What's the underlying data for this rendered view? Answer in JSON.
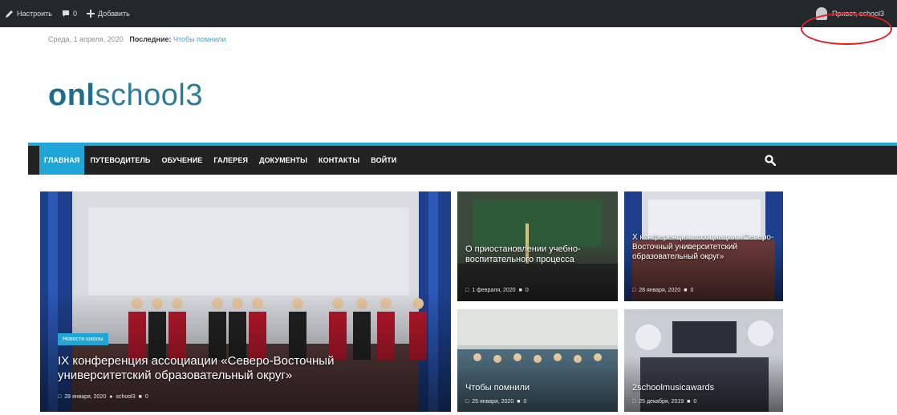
{
  "admin_bar": {
    "customize": "Настроить",
    "comments_count": "0",
    "add_new": "Добавить",
    "howdy": "Привет, school3"
  },
  "top_info": {
    "date": "Среда, 1 апреля, 2020",
    "latest_label": "Последние:",
    "latest_link": "Чтобы помнили"
  },
  "logo": {
    "text_bold": "onl",
    "text_rest": "school3"
  },
  "nav": {
    "items": [
      "ГЛАВНАЯ",
      "ПУТЕВОДИТЕЛЬ",
      "ОБУЧЕНИЕ",
      "ГАЛЕРЕЯ",
      "ДОКУМЕНТЫ",
      "КОНТАКТЫ",
      "ВОЙТИ"
    ]
  },
  "featured": {
    "category": "Новости школы",
    "title_line1": "IX конференция ассоциации «Северо-Восточный",
    "title_line2": "университетский образовательный округ»",
    "date": "28 января, 2020",
    "author": "school3",
    "comments": "0"
  },
  "tiles": [
    {
      "title": "О приостановлении учебно-воспитательного процесса",
      "date": "1 февраля, 2020",
      "comments": "0"
    },
    {
      "title": "Х конференция ассоциации «Северо-Восточный университетский образовательный округ»",
      "date": "28 января, 2020",
      "comments": "0"
    },
    {
      "title": "Чтобы помнили",
      "date": "25 января, 2020",
      "comments": "0"
    },
    {
      "title": "2schoolmusicawards",
      "date": "25 декабря, 2019",
      "comments": "0"
    }
  ],
  "colors": {
    "accent": "#1fa6d6",
    "admin_bar": "#23282d",
    "nav_bg": "#222222",
    "highlight": "#e21b23"
  }
}
